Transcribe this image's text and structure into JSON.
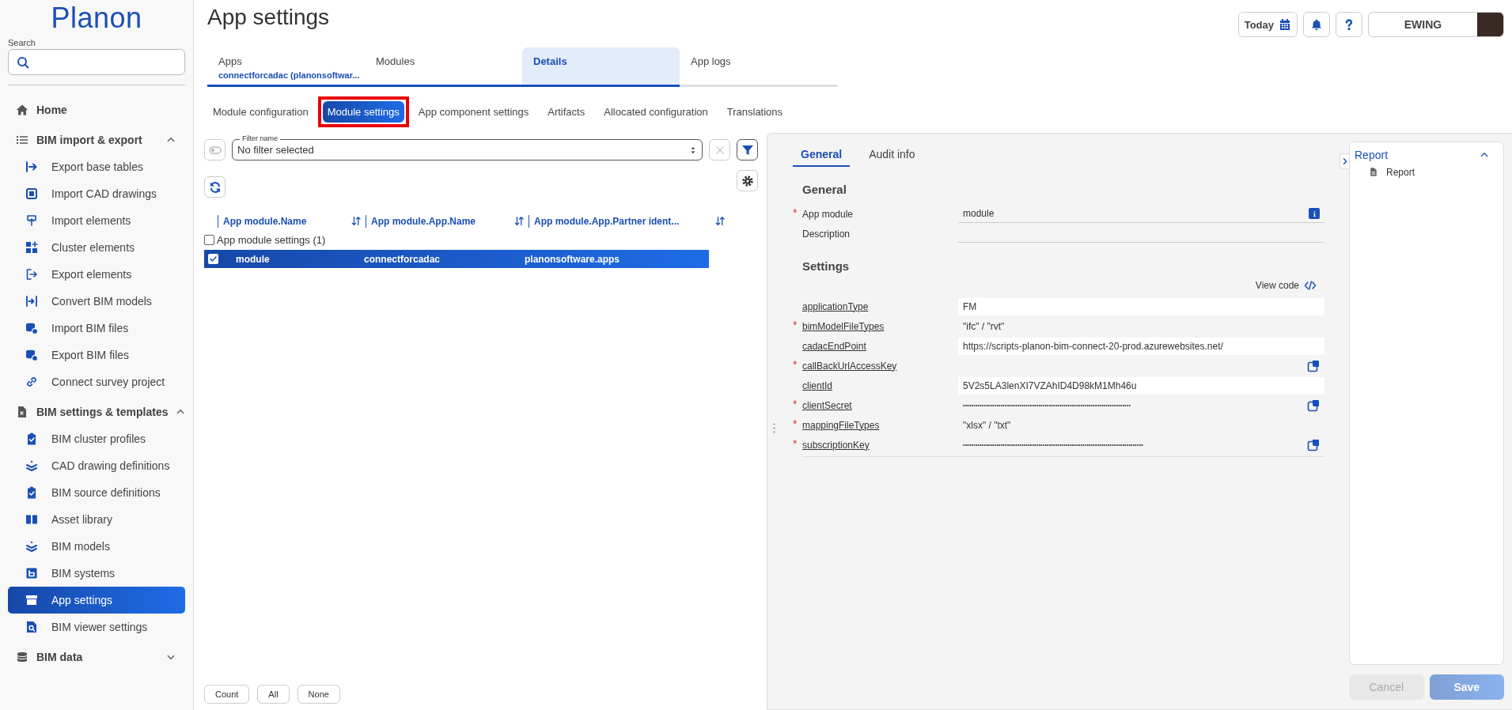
{
  "logo": "Planon",
  "sidebar": {
    "search_label": "Search",
    "nav": [
      {
        "label": "Home",
        "selected": false
      },
      {
        "label": "BIM import & export",
        "selected": false,
        "expanded": true,
        "children": [
          {
            "label": "Export base tables",
            "selected": false
          },
          {
            "label": "Import CAD drawings",
            "selected": false
          },
          {
            "label": "Import elements",
            "selected": false
          },
          {
            "label": "Cluster elements",
            "selected": false
          },
          {
            "label": "Export elements",
            "selected": false
          },
          {
            "label": "Convert BIM models",
            "selected": false
          },
          {
            "label": "Import BIM files",
            "selected": false
          },
          {
            "label": "Export BIM files",
            "selected": false
          },
          {
            "label": "Connect survey project",
            "selected": false
          }
        ]
      },
      {
        "label": "BIM settings & templates",
        "selected": false,
        "expanded": true,
        "children": [
          {
            "label": "BIM cluster profiles",
            "selected": false
          },
          {
            "label": "CAD drawing definitions",
            "selected": false
          },
          {
            "label": "BIM source definitions",
            "selected": false
          },
          {
            "label": "Asset library",
            "selected": false
          },
          {
            "label": "BIM models",
            "selected": false
          },
          {
            "label": "BIM systems",
            "selected": false
          },
          {
            "label": "App settings",
            "selected": true
          },
          {
            "label": "BIM viewer settings",
            "selected": false
          }
        ]
      },
      {
        "label": "BIM data",
        "selected": false,
        "expanded": false
      }
    ]
  },
  "header": {
    "title": "App settings",
    "today": "Today",
    "user": "EWING"
  },
  "tabs": [
    {
      "label": "Apps",
      "sublabel": "connectforcadac (planonsoftwar...",
      "selected": false
    },
    {
      "label": "Modules",
      "selected": false
    },
    {
      "label": "Details",
      "selected": true
    },
    {
      "label": "App logs",
      "selected": false
    }
  ],
  "subtabs": [
    {
      "label": "Module configuration",
      "selected": false,
      "highlighted": false
    },
    {
      "label": "Module settings",
      "selected": true,
      "highlighted": true
    },
    {
      "label": "App component settings",
      "selected": false,
      "highlighted": false
    },
    {
      "label": "Artifacts",
      "selected": false,
      "highlighted": false
    },
    {
      "label": "Allocated configuration",
      "selected": false,
      "highlighted": false
    },
    {
      "label": "Translations",
      "selected": false,
      "highlighted": false
    }
  ],
  "filter": {
    "label": "Filter name",
    "value": "No filter selected"
  },
  "table": {
    "columns": [
      "App module.Name",
      "App module.App.Name",
      "App module.App.Partner ident..."
    ],
    "group": {
      "label": "App module settings (1)",
      "checked": false
    },
    "rows": [
      {
        "cells": [
          "module",
          "connectforcadac",
          "planonsoftware.apps"
        ],
        "selected": true,
        "checked": true
      }
    ]
  },
  "list_buttons": [
    "Count",
    "All",
    "None"
  ],
  "detail": {
    "tabs": [
      {
        "label": "General",
        "selected": true
      },
      {
        "label": "Audit info",
        "selected": false
      }
    ],
    "general_heading": "General",
    "general_fields": [
      {
        "label": "App module",
        "required_mark": "*",
        "kind": "info",
        "value": "module"
      },
      {
        "label": "Description",
        "kind": "line"
      }
    ],
    "settings_heading": "Settings",
    "view_code": "View code",
    "settings": [
      {
        "label": "applicationType",
        "kind": "field",
        "value": "FM"
      },
      {
        "label": "bimModelFileTypes",
        "required_mark": "*",
        "kind": "list",
        "value": "\"ifc\" / \"rvt\""
      },
      {
        "label": "cadacEndPoint",
        "kind": "field",
        "value": "https://scripts-planon-bim-connect-20-prod.azurewebsites.net/"
      },
      {
        "label": "callBackUrlAccessKey",
        "required_mark": "*",
        "kind": "secret"
      },
      {
        "label": "clientId",
        "kind": "field",
        "value": "5V2s5LA3lenXI7VZAhID4D98kM1Mh46u"
      },
      {
        "label": "clientSecret",
        "required_mark": "*",
        "kind": "secret",
        "value": "••••••••••••••••••••••••••••••••••••••••••••••••••••••••••••••••••••••••••••••••"
      },
      {
        "label": "mappingFileTypes",
        "required_mark": "*",
        "kind": "list",
        "value": "\"xlsx\" / \"txt\""
      },
      {
        "label": "subscriptionKey",
        "required_mark": "*",
        "kind": "secret",
        "value": "••••••••••••••••••••••••••••••••••••••••••••••••••••••••••••••••••••••••••••••••••••••"
      }
    ]
  },
  "report": {
    "title": "Report",
    "expanded": true,
    "items": [
      "Report"
    ]
  },
  "actions": [
    {
      "label": "Cancel",
      "kind": "secondary",
      "disabled": true
    },
    {
      "label": "Save",
      "kind": "primary",
      "disabled": true
    }
  ]
}
